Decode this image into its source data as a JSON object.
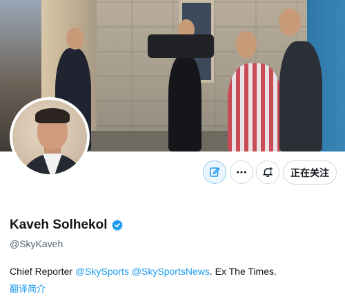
{
  "profile": {
    "name": "Kaveh Solhekol",
    "handle": "@SkyKaveh",
    "verified": true,
    "bio": {
      "prefix": "Chief Reporter ",
      "mention1": "@SkySports",
      "space": " ",
      "mention2": "@SkySportsNews",
      "suffix": ". Ex The Times."
    },
    "translate_label": "翻译简介"
  },
  "actions": {
    "edit_icon": "edit-icon",
    "more_icon": "more-icon",
    "notify_icon": "bell-plus-icon",
    "follow_label": "正在关注"
  },
  "colors": {
    "accent": "#1d9bf0",
    "text": "#0f1419",
    "muted": "#536471",
    "border": "#cfd9de"
  }
}
